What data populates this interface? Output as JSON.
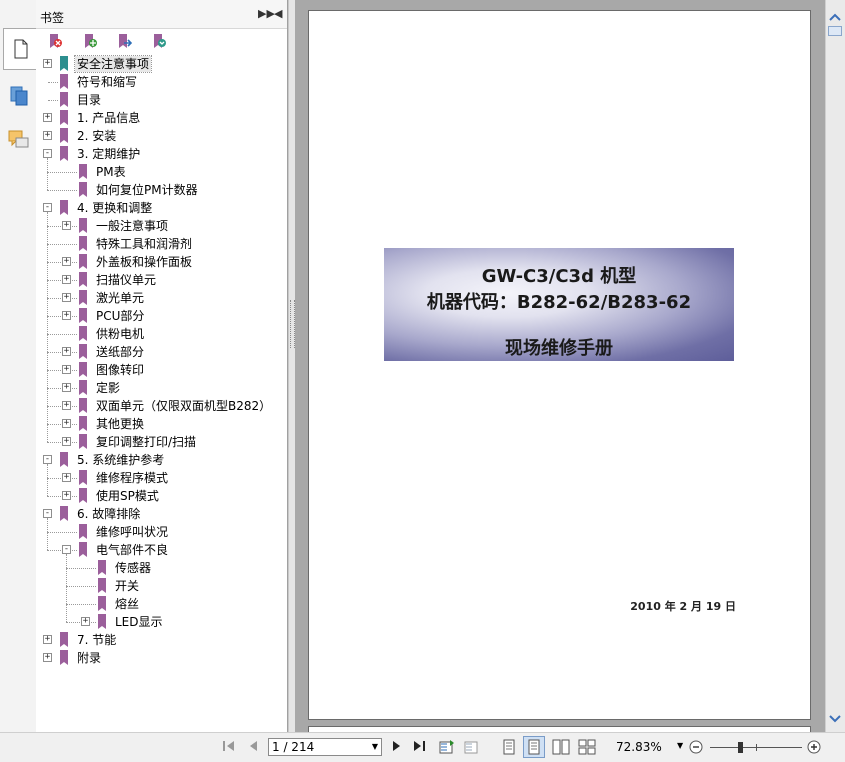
{
  "panel": {
    "title": "书签"
  },
  "bookmarks": [
    {
      "label": "安全注意事项",
      "level": 0,
      "expander": "+",
      "selected": true,
      "color": "#2d8f8f"
    },
    {
      "label": "符号和缩写",
      "level": 0,
      "expander": "",
      "color": "#9b5f9b"
    },
    {
      "label": "目录",
      "level": 0,
      "expander": "",
      "color": "#9b5f9b"
    },
    {
      "label": "1. 产品信息",
      "level": 0,
      "expander": "+",
      "color": "#9b5f9b"
    },
    {
      "label": "2. 安装",
      "level": 0,
      "expander": "+",
      "color": "#9b5f9b"
    },
    {
      "label": "3. 定期维护",
      "level": 0,
      "expander": "−",
      "color": "#9b5f9b"
    },
    {
      "label": "PM表",
      "level": 1,
      "expander": "",
      "color": "#9b5f9b"
    },
    {
      "label": "如何复位PM计数器",
      "level": 1,
      "expander": "",
      "color": "#9b5f9b"
    },
    {
      "label": "4. 更换和调整",
      "level": 0,
      "expander": "−",
      "color": "#9b5f9b"
    },
    {
      "label": "一般注意事项",
      "level": 1,
      "expander": "+",
      "color": "#9b5f9b"
    },
    {
      "label": "特殊工具和润滑剂",
      "level": 1,
      "expander": "",
      "color": "#9b5f9b"
    },
    {
      "label": "外盖板和操作面板",
      "level": 1,
      "expander": "+",
      "color": "#9b5f9b"
    },
    {
      "label": "扫描仪单元",
      "level": 1,
      "expander": "+",
      "color": "#9b5f9b"
    },
    {
      "label": "激光单元",
      "level": 1,
      "expander": "+",
      "color": "#9b5f9b"
    },
    {
      "label": "PCU部分",
      "level": 1,
      "expander": "+",
      "color": "#9b5f9b"
    },
    {
      "label": "供粉电机",
      "level": 1,
      "expander": "",
      "color": "#9b5f9b"
    },
    {
      "label": "送纸部分",
      "level": 1,
      "expander": "+",
      "color": "#9b5f9b"
    },
    {
      "label": "图像转印",
      "level": 1,
      "expander": "+",
      "color": "#9b5f9b"
    },
    {
      "label": "定影",
      "level": 1,
      "expander": "+",
      "color": "#9b5f9b"
    },
    {
      "label": "双面单元（仅限双面机型B282）",
      "level": 1,
      "expander": "+",
      "color": "#9b5f9b"
    },
    {
      "label": "其他更换",
      "level": 1,
      "expander": "+",
      "color": "#9b5f9b"
    },
    {
      "label": "复印调整打印/扫描",
      "level": 1,
      "expander": "+",
      "color": "#9b5f9b"
    },
    {
      "label": "5. 系统维护参考",
      "level": 0,
      "expander": "−",
      "color": "#9b5f9b"
    },
    {
      "label": "维修程序模式",
      "level": 1,
      "expander": "+",
      "color": "#9b5f9b"
    },
    {
      "label": "使用SP模式",
      "level": 1,
      "expander": "+",
      "color": "#9b5f9b"
    },
    {
      "label": "6. 故障排除",
      "level": 0,
      "expander": "−",
      "color": "#9b5f9b"
    },
    {
      "label": "维修呼叫状况",
      "level": 1,
      "expander": "",
      "color": "#9b5f9b"
    },
    {
      "label": "电气部件不良",
      "level": 1,
      "expander": "−",
      "color": "#9b5f9b"
    },
    {
      "label": "传感器",
      "level": 2,
      "expander": "",
      "color": "#9b5f9b"
    },
    {
      "label": "开关",
      "level": 2,
      "expander": "",
      "color": "#9b5f9b"
    },
    {
      "label": "熔丝",
      "level": 2,
      "expander": "",
      "color": "#9b5f9b"
    },
    {
      "label": "LED显示",
      "level": 2,
      "expander": "+",
      "color": "#9b5f9b"
    },
    {
      "label": "7. 节能",
      "level": 0,
      "expander": "+",
      "color": "#9b5f9b"
    },
    {
      "label": "附录",
      "level": 0,
      "expander": "+",
      "color": "#9b5f9b"
    }
  ],
  "document": {
    "title_line1": "GW-C3/C3d 机型",
    "title_line2": "机器代码：B282-62/B283-62",
    "title_line3": "现场维修手册",
    "date": "2010 年 2 月 19 日"
  },
  "toolbar": {
    "page_field": "1 / 214",
    "zoom": "72.83%"
  },
  "colors": {
    "accent": "#9b5f9b",
    "banner_dark": "#5e5e9a"
  }
}
